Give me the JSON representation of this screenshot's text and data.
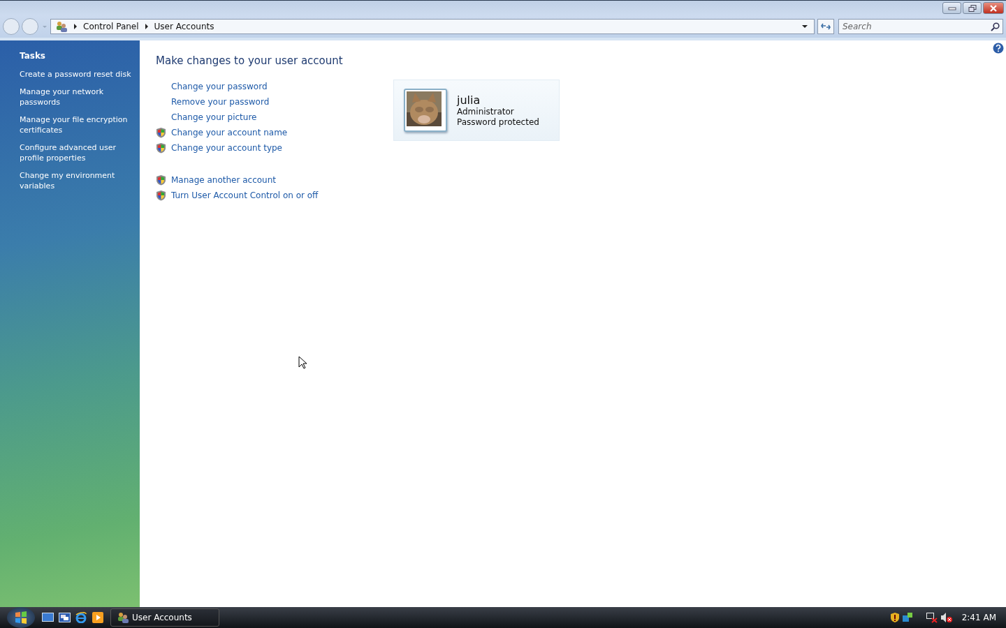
{
  "address_bar": {
    "crumbs": [
      "Control Panel",
      "User Accounts"
    ]
  },
  "search": {
    "placeholder": "Search"
  },
  "sidebar": {
    "heading": "Tasks",
    "items": [
      "Create a password reset disk",
      "Manage your network passwords",
      "Manage your file encryption certificates",
      "Configure advanced user profile properties",
      "Change my environment variables"
    ]
  },
  "main": {
    "title": "Make changes to your user account",
    "link_groups": [
      [
        {
          "label": "Change your password",
          "kind": "plain"
        },
        {
          "label": "Remove your password",
          "kind": "plain"
        },
        {
          "label": "Change your picture",
          "kind": "plain"
        },
        {
          "label": "Change your account name",
          "kind": "shield"
        },
        {
          "label": "Change your account type",
          "kind": "shield"
        }
      ],
      [
        {
          "label": "Manage another account",
          "kind": "shield"
        },
        {
          "label": "Turn User Account Control on or off",
          "kind": "shield"
        }
      ]
    ],
    "account": {
      "name": "julia",
      "role": "Administrator",
      "status": "Password protected"
    }
  },
  "taskbar": {
    "task": "User Accounts",
    "clock": "2:41 AM"
  }
}
